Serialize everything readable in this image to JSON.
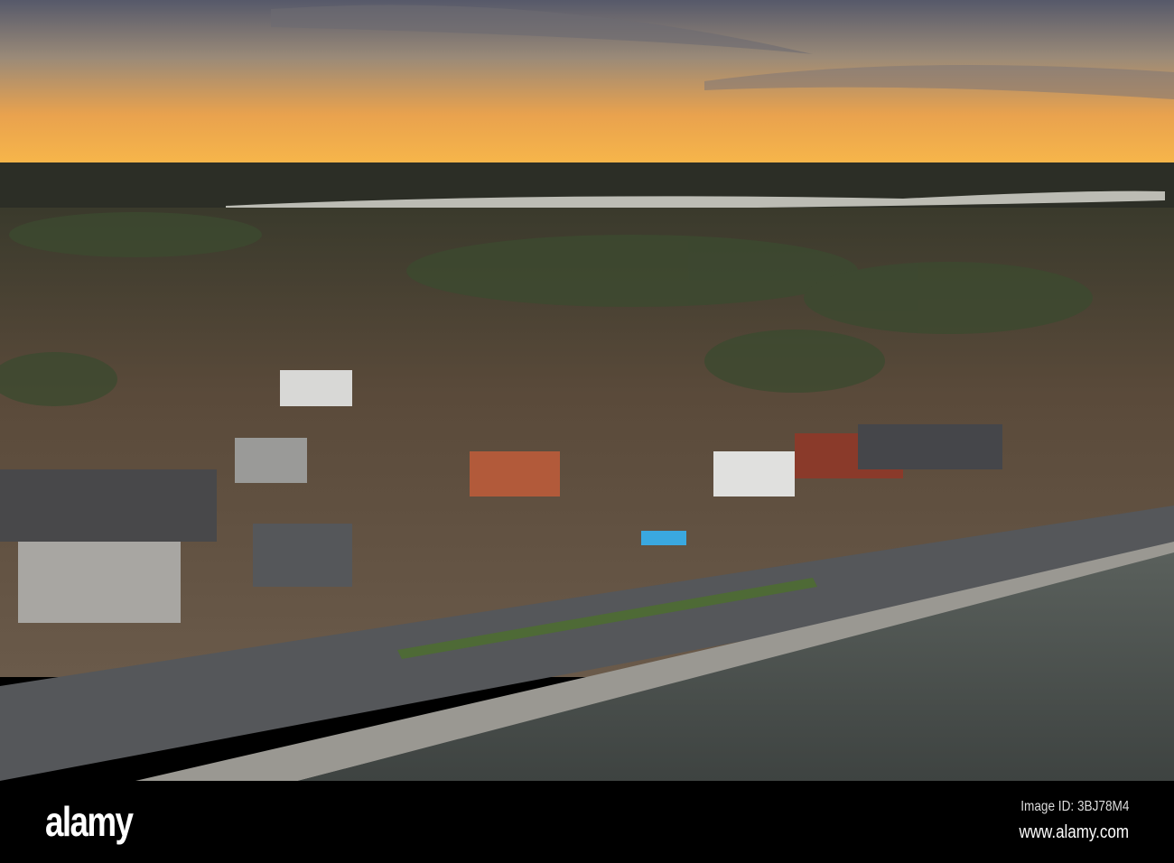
{
  "photo": {
    "subject": "aerial-town-waterfront-sunset"
  },
  "footer": {
    "logo": "alamy",
    "image_id": "Image ID: 3BJ78M4",
    "website": "www.alamy.com"
  },
  "colors": {
    "sky_top": "#56596a",
    "sky_horizon": "#f3a33c",
    "water": "#4a4f4c",
    "road": "#55575a"
  }
}
